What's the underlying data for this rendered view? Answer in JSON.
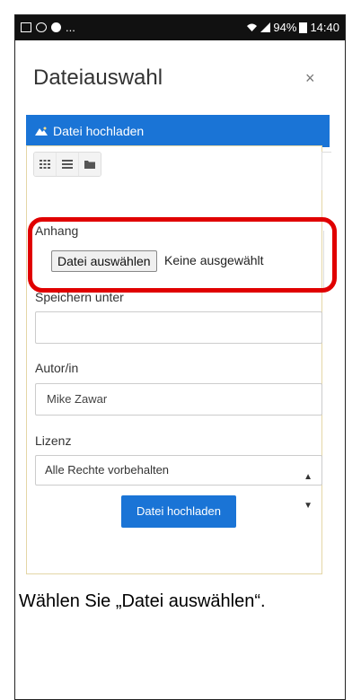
{
  "status_bar": {
    "battery": "94%",
    "time": "14:40",
    "ellipsis": "..."
  },
  "dialog": {
    "title": "Dateiauswahl",
    "close": "×"
  },
  "repository": {
    "active_item": "Datei hochladen"
  },
  "form": {
    "attachment_label": "Anhang",
    "choose_file_button": "Datei auswählen",
    "file_status": "Keine ausgewählt",
    "save_as_label": "Speichern unter",
    "save_as_value": "",
    "author_label": "Autor/in",
    "author_value": "Mike Zawar",
    "license_label": "Lizenz",
    "license_value": "Alle Rechte vorbehalten",
    "submit_button": "Datei hochladen"
  },
  "caption": "Wählen Sie „Datei auswählen“.",
  "colors": {
    "accent": "#1a74d6",
    "highlight": "#e00000"
  },
  "icons": [
    "image-icon",
    "wifi-icon",
    "signal-icon",
    "battery-icon",
    "mountain-icon",
    "grid-view-icon",
    "list-view-icon",
    "folder-view-icon",
    "close-icon",
    "select-caret-icon"
  ]
}
